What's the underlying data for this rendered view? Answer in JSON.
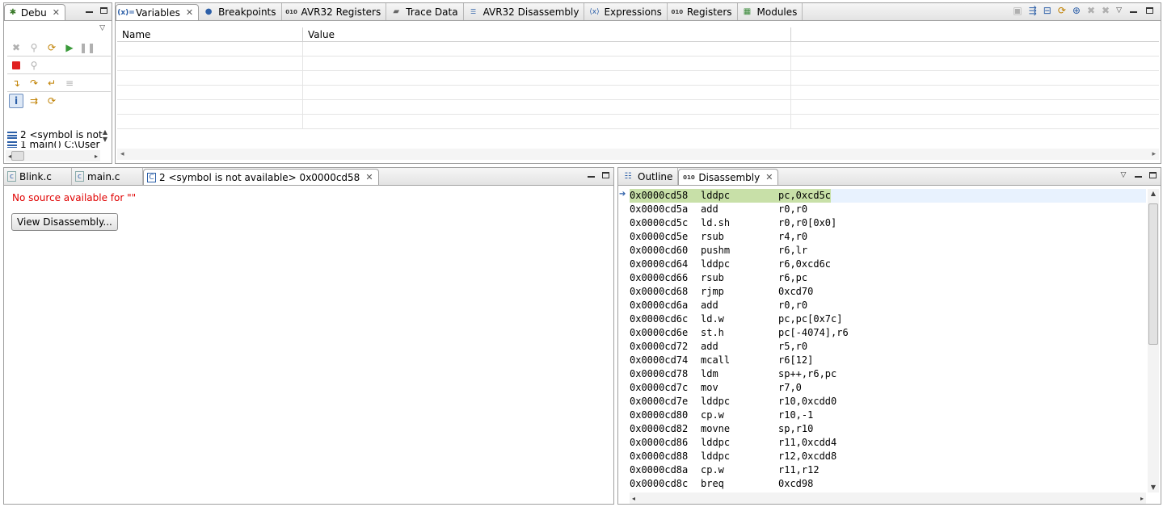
{
  "debug_view": {
    "tab_label": "Debu",
    "stack_items": [
      {
        "label": "2 <symbol is not"
      },
      {
        "label": "1 main() C:\\User"
      }
    ]
  },
  "top_tabs": [
    {
      "label": "Variables",
      "icon": "variables-icon",
      "active": true
    },
    {
      "label": "Breakpoints",
      "icon": "breakpoints-icon"
    },
    {
      "label": "AVR32 Registers",
      "icon": "registers-icon"
    },
    {
      "label": "Trace Data",
      "icon": "trace-icon"
    },
    {
      "label": "AVR32 Disassembly",
      "icon": "disassembly-icon"
    },
    {
      "label": "Expressions",
      "icon": "expressions-icon"
    },
    {
      "label": "Registers",
      "icon": "registers-icon"
    },
    {
      "label": "Modules",
      "icon": "modules-icon"
    }
  ],
  "variables": {
    "columns": [
      "Name",
      "Value"
    ]
  },
  "editor": {
    "tabs": [
      {
        "label": "Blink.c"
      },
      {
        "label": "main.c"
      },
      {
        "label": "2 <symbol is not available> 0x0000cd58",
        "active": true
      }
    ],
    "no_source_message": "No source available for \"\"",
    "view_disassembly_button": "View Disassembly..."
  },
  "disassembly_panel": {
    "tabs": [
      {
        "label": "Outline"
      },
      {
        "label": "Disassembly",
        "active": true
      }
    ],
    "current_line_index": 0,
    "lines": [
      {
        "addr": "0x0000cd58",
        "mnemonic": "lddpc",
        "operands": "pc,0xcd5c"
      },
      {
        "addr": "0x0000cd5a",
        "mnemonic": "add",
        "operands": "r0,r0"
      },
      {
        "addr": "0x0000cd5c",
        "mnemonic": "ld.sh",
        "operands": "r0,r0[0x0]"
      },
      {
        "addr": "0x0000cd5e",
        "mnemonic": "rsub",
        "operands": "r4,r0"
      },
      {
        "addr": "0x0000cd60",
        "mnemonic": "pushm",
        "operands": "r6,lr"
      },
      {
        "addr": "0x0000cd64",
        "mnemonic": "lddpc",
        "operands": "r6,0xcd6c"
      },
      {
        "addr": "0x0000cd66",
        "mnemonic": "rsub",
        "operands": "r6,pc"
      },
      {
        "addr": "0x0000cd68",
        "mnemonic": "rjmp",
        "operands": "0xcd70"
      },
      {
        "addr": "0x0000cd6a",
        "mnemonic": "add",
        "operands": "r0,r0"
      },
      {
        "addr": "0x0000cd6c",
        "mnemonic": "ld.w",
        "operands": "pc,pc[0x7c]"
      },
      {
        "addr": "0x0000cd6e",
        "mnemonic": "st.h",
        "operands": "pc[-4074],r6"
      },
      {
        "addr": "0x0000cd72",
        "mnemonic": "add",
        "operands": "r5,r0"
      },
      {
        "addr": "0x0000cd74",
        "mnemonic": "mcall",
        "operands": "r6[12]"
      },
      {
        "addr": "0x0000cd78",
        "mnemonic": "ldm",
        "operands": "sp++,r6,pc"
      },
      {
        "addr": "0x0000cd7c",
        "mnemonic": "mov",
        "operands": "r7,0"
      },
      {
        "addr": "0x0000cd7e",
        "mnemonic": "lddpc",
        "operands": "r10,0xcdd0"
      },
      {
        "addr": "0x0000cd80",
        "mnemonic": "cp.w",
        "operands": "r10,-1"
      },
      {
        "addr": "0x0000cd82",
        "mnemonic": "movne",
        "operands": "sp,r10"
      },
      {
        "addr": "0x0000cd86",
        "mnemonic": "lddpc",
        "operands": "r11,0xcdd4"
      },
      {
        "addr": "0x0000cd88",
        "mnemonic": "lddpc",
        "operands": "r12,0xcdd8"
      },
      {
        "addr": "0x0000cd8a",
        "mnemonic": "cp.w",
        "operands": "r11,r12"
      },
      {
        "addr": "0x0000cd8c",
        "mnemonic": "breq",
        "operands": "0xcd98"
      }
    ]
  }
}
